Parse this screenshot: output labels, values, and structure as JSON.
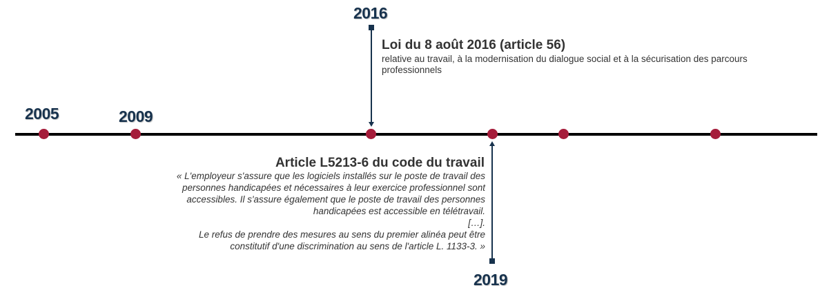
{
  "timeline": {
    "years": {
      "y2005": "2005",
      "y2009": "2009",
      "y2016": "2016",
      "y2019": "2019"
    },
    "events": {
      "loi_2016": {
        "title": "Loi du 8 août 2016 (article 56)",
        "description": "relative au travail, à la modernisation du dialogue social et à la sécurisation des parcours professionnels"
      },
      "article_l5213": {
        "title": "Article L5213-6 du code du travail",
        "quote": "« L'employeur s'assure que les logiciels installés sur le poste de travail des\npersonnes handicapées et nécessaires à leur exercice professionnel sont\naccessibles. Il s'assure également que le poste de travail des personnes\nhandicapées est accessible en télétravail.\n[…].\nLe refus de prendre des mesures au sens du premier alinéa peut être\nconstitutif d'une discrimination au sens de l'article L. 1133-3. »"
      }
    },
    "colors": {
      "axis": "#000000",
      "dot": "#a51c3a",
      "year_text": "#17324d",
      "connector": "#17324d",
      "body_text": "#333333"
    }
  }
}
